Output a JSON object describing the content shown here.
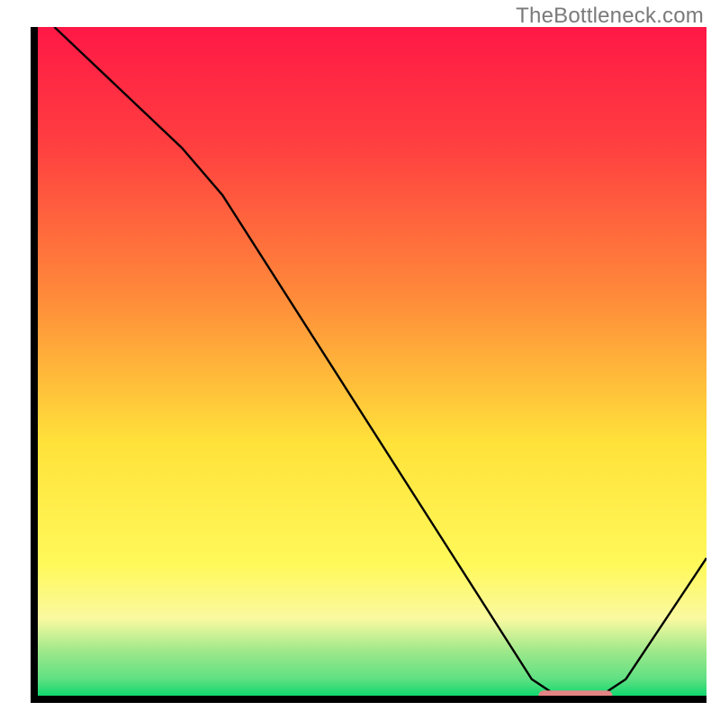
{
  "watermark": "TheBottleneck.com",
  "chart_data": {
    "type": "line",
    "title": "",
    "xlabel": "",
    "ylabel": "",
    "xlim": [
      0,
      100
    ],
    "ylim": [
      0,
      100
    ],
    "background_gradient": {
      "top": "#ff1846",
      "mid_upper": "#ff8a3a",
      "mid": "#ffe23a",
      "mid_lower": "#faf9a0",
      "near_bottom": "#9be88a",
      "bottom": "#00d66a"
    },
    "curve_points": [
      {
        "x": 3,
        "y": 100
      },
      {
        "x": 22,
        "y": 82
      },
      {
        "x": 28,
        "y": 75
      },
      {
        "x": 74,
        "y": 3
      },
      {
        "x": 77,
        "y": 1
      },
      {
        "x": 85,
        "y": 1
      },
      {
        "x": 88,
        "y": 3
      },
      {
        "x": 100,
        "y": 21
      }
    ],
    "marker": {
      "x_start": 75,
      "x_end": 86,
      "y": 0.5,
      "color": "#e48585",
      "height_frac": 0.016
    },
    "axes_color": "#000000"
  }
}
